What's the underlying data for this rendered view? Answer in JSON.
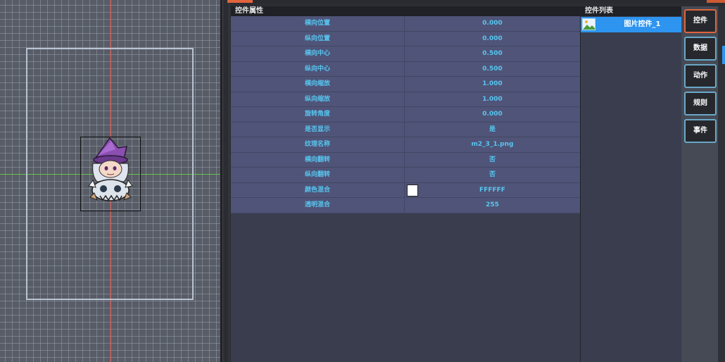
{
  "properties_panel": {
    "title": "控件属性",
    "rows": [
      {
        "name": "横向位置",
        "value": "0.000"
      },
      {
        "name": "纵向位置",
        "value": "0.000"
      },
      {
        "name": "横向中心",
        "value": "0.500"
      },
      {
        "name": "纵向中心",
        "value": "0.500"
      },
      {
        "name": "横向缩放",
        "value": "1.000"
      },
      {
        "name": "纵向缩放",
        "value": "1.000"
      },
      {
        "name": "旋转角度",
        "value": "0.000"
      },
      {
        "name": "是否显示",
        "value": "是"
      },
      {
        "name": "纹理名称",
        "value": "m2_3_1.png"
      },
      {
        "name": "横向翻转",
        "value": "否"
      },
      {
        "name": "纵向翻转",
        "value": "否"
      },
      {
        "name": "颜色混合",
        "value": "FFFFFF",
        "swatch_color": "#ffffff"
      },
      {
        "name": "透明混合",
        "value": "255"
      }
    ]
  },
  "control_list": {
    "title": "控件列表",
    "items": [
      {
        "label": "图片控件_1",
        "icon": "image-icon",
        "selected": true
      }
    ]
  },
  "tool_buttons": [
    {
      "label": "控件",
      "active": true
    },
    {
      "label": "数据",
      "active": false
    },
    {
      "label": "动作",
      "active": false
    },
    {
      "label": "规则",
      "active": false
    },
    {
      "label": "事件",
      "active": false
    }
  ],
  "colors": {
    "accent": "#e0653c",
    "selection": "#2d95f0",
    "value_text": "#57c6f0",
    "x_axis": "#e2463c",
    "y_axis": "#6bc24a"
  }
}
